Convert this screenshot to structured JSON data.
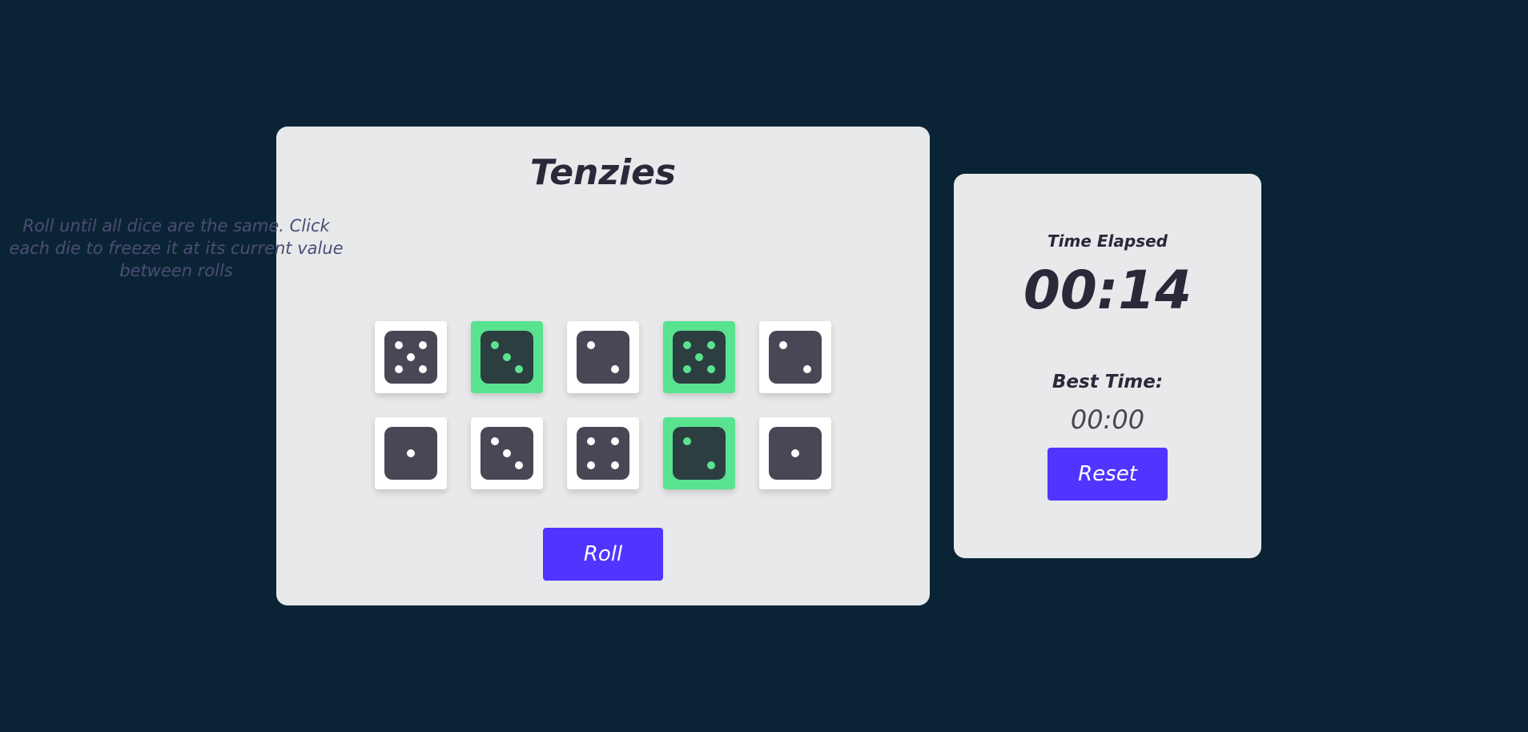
{
  "game": {
    "title": "Tenzies",
    "instructions": "Roll until all dice are the same. Click each die to freeze it at its current value between rolls",
    "roll_label": "Roll",
    "dice": [
      {
        "value": 5,
        "held": false
      },
      {
        "value": 3,
        "held": true
      },
      {
        "value": 2,
        "held": false
      },
      {
        "value": 5,
        "held": true
      },
      {
        "value": 2,
        "held": false
      },
      {
        "value": 1,
        "held": false
      },
      {
        "value": 3,
        "held": false
      },
      {
        "value": 4,
        "held": false
      },
      {
        "value": 2,
        "held": true
      },
      {
        "value": 1,
        "held": false
      }
    ]
  },
  "timer": {
    "elapsed_label": "Time Elapsed",
    "elapsed_value": "00:14",
    "best_label": "Best Time:",
    "best_value": "00:00",
    "reset_label": "Reset"
  },
  "colors": {
    "background": "#0b2435",
    "card": "#e8e9eb",
    "held": "#59e391",
    "button": "#5035ff",
    "die_face": "#4a4655"
  }
}
